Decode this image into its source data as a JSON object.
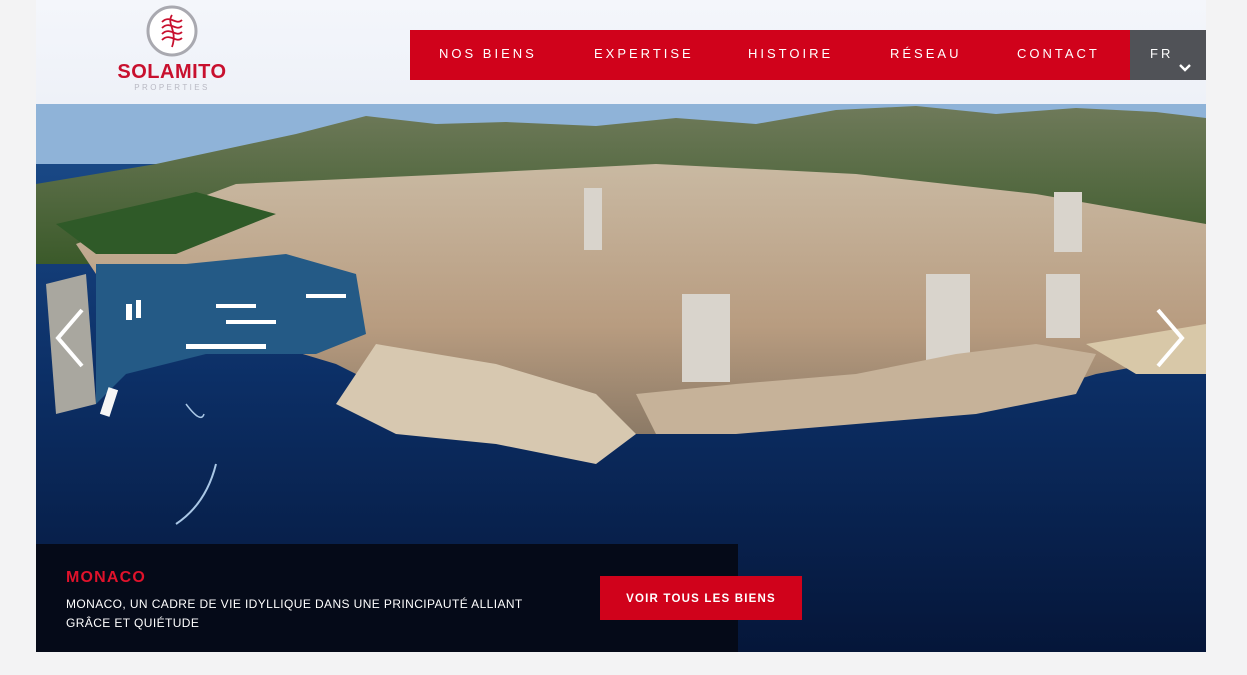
{
  "brand": {
    "name": "SOLAMITO",
    "subtitle": "PROPERTIES"
  },
  "nav": {
    "items": [
      {
        "label": "NOS BIENS"
      },
      {
        "label": "EXPERTISE"
      },
      {
        "label": "HISTOIRE"
      },
      {
        "label": "RÉSEAU"
      },
      {
        "label": "CONTACT"
      }
    ],
    "language": "FR"
  },
  "hero": {
    "title": "MONACO",
    "description": "MONACO, UN CADRE DE VIE IDYLLIQUE DANS UNE PRINCIPAUTÉ ALLIANT GRÂCE ET QUIÉTUDE",
    "cta_label": "VOIR TOUS LES BIENS"
  },
  "colors": {
    "accent": "#d0021b",
    "caption_bg": "#050a18",
    "lang_bg": "#505257"
  },
  "icons": {
    "logo": "solamito-emblem",
    "language_dropdown": "chevron-down-icon",
    "prev": "chevron-left-icon",
    "next": "chevron-right-icon"
  }
}
